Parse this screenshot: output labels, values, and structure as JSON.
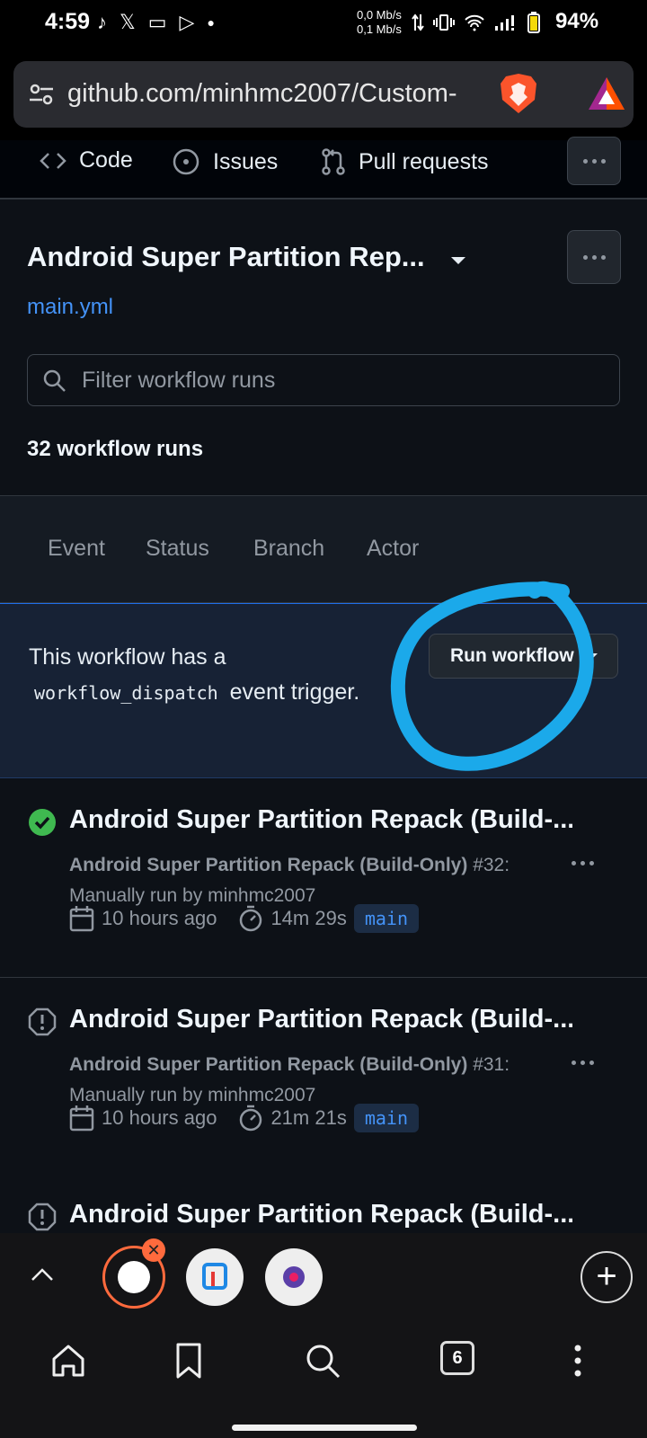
{
  "status_bar": {
    "time": "4:59",
    "speed_down": "0,0 Mb/s",
    "speed_up": "0,1 Mb/s",
    "battery": "94%"
  },
  "browser": {
    "url": "github.com/minhmc2007/Custom-",
    "open_tab_count": "6"
  },
  "repo_nav": {
    "code_label": "Code",
    "issues_label": "Issues",
    "pulls_label": "Pull requests"
  },
  "workflow": {
    "title": "Android Super Partition Rep...",
    "file": "main.yml",
    "filter_placeholder": "Filter workflow runs",
    "run_count": "32 workflow runs"
  },
  "filter_tabs": [
    "Event",
    "Status",
    "Branch",
    "Actor"
  ],
  "dispatch": {
    "text_before": "This workflow has a",
    "code": "workflow_dispatch",
    "text_after": "event trigger.",
    "button_label": "Run workflow"
  },
  "runs": [
    {
      "status": "success",
      "title": "Android Super Partition Repack (Build-...",
      "workflow_name": "Android Super Partition Repack (Build-Only)",
      "number": "#32:",
      "trigger": "Manually run by minhmc2007",
      "time_ago": "10 hours ago",
      "duration": "14m 29s",
      "branch": "main"
    },
    {
      "status": "failure",
      "title": "Android Super Partition Repack (Build-...",
      "workflow_name": "Android Super Partition Repack (Build-Only)",
      "number": "#31:",
      "trigger": "Manually run by minhmc2007",
      "time_ago": "10 hours ago",
      "duration": "21m 21s",
      "branch": "main"
    },
    {
      "status": "failure",
      "title": "Android Super Partition Repack (Build-..."
    }
  ],
  "colors": {
    "background": "#0d1117",
    "accent_link": "#4493f8",
    "success": "#3fb950",
    "annotation_circle": "#1ba9ea",
    "brave_orange": "#ff6a3d"
  }
}
